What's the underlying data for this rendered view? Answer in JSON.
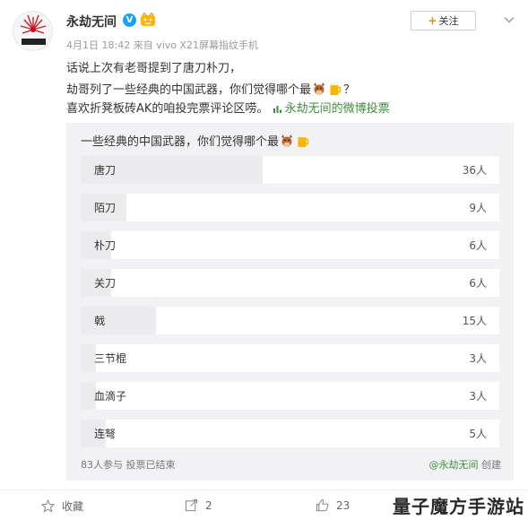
{
  "post": {
    "username": "永劫无间",
    "verified_mark": "V",
    "follow_plus": "+",
    "follow_label": "关注",
    "meta": "4月1日 18:42 来自 vivo X21屏幕指纹手机",
    "line1": "话说上次有老哥提到了唐刀朴刀，",
    "line2_prefix": "劫哥列了一些经典的中国武器，你们觉得哪个最",
    "line2_suffix": "？",
    "line3_prefix": "喜欢折凳板砖AK的咱投完票评论区唠。",
    "poll_link": "永劫无间的微博投票"
  },
  "poll": {
    "question": "一些经典的中国武器，你们觉得哪个最",
    "total_votes": 83,
    "options": [
      {
        "label": "唐刀",
        "count": "36人",
        "votes": 36
      },
      {
        "label": "陌刀",
        "count": "9人",
        "votes": 9
      },
      {
        "label": "朴刀",
        "count": "6人",
        "votes": 6
      },
      {
        "label": "关刀",
        "count": "6人",
        "votes": 6
      },
      {
        "label": "戟",
        "count": "15人",
        "votes": 15
      },
      {
        "label": "三节棍",
        "count": "3人",
        "votes": 3
      },
      {
        "label": "血滴子",
        "count": "3人",
        "votes": 3
      },
      {
        "label": "连弩",
        "count": "5人",
        "votes": 5
      }
    ],
    "footer_left": "83人参与  投票已结束",
    "creator": "@永劫无间",
    "creator_suffix": " 创建"
  },
  "actions": {
    "favorite": "收藏",
    "forward": "2",
    "like": "23"
  },
  "watermark": "量子魔方手游站",
  "colors": {
    "link_green": "#3f8f3a",
    "verified_blue": "#1da1f2",
    "follow_orange": "#ff8200",
    "poll_bg": "#f2f2f5"
  },
  "icons": [
    "avatar-logo",
    "verified-icon",
    "member-icon",
    "chevron-down-icon",
    "cow-emoji-icon",
    "beer-emoji-icon",
    "poll-icon",
    "star-icon",
    "share-icon",
    "thumb-up-icon"
  ]
}
